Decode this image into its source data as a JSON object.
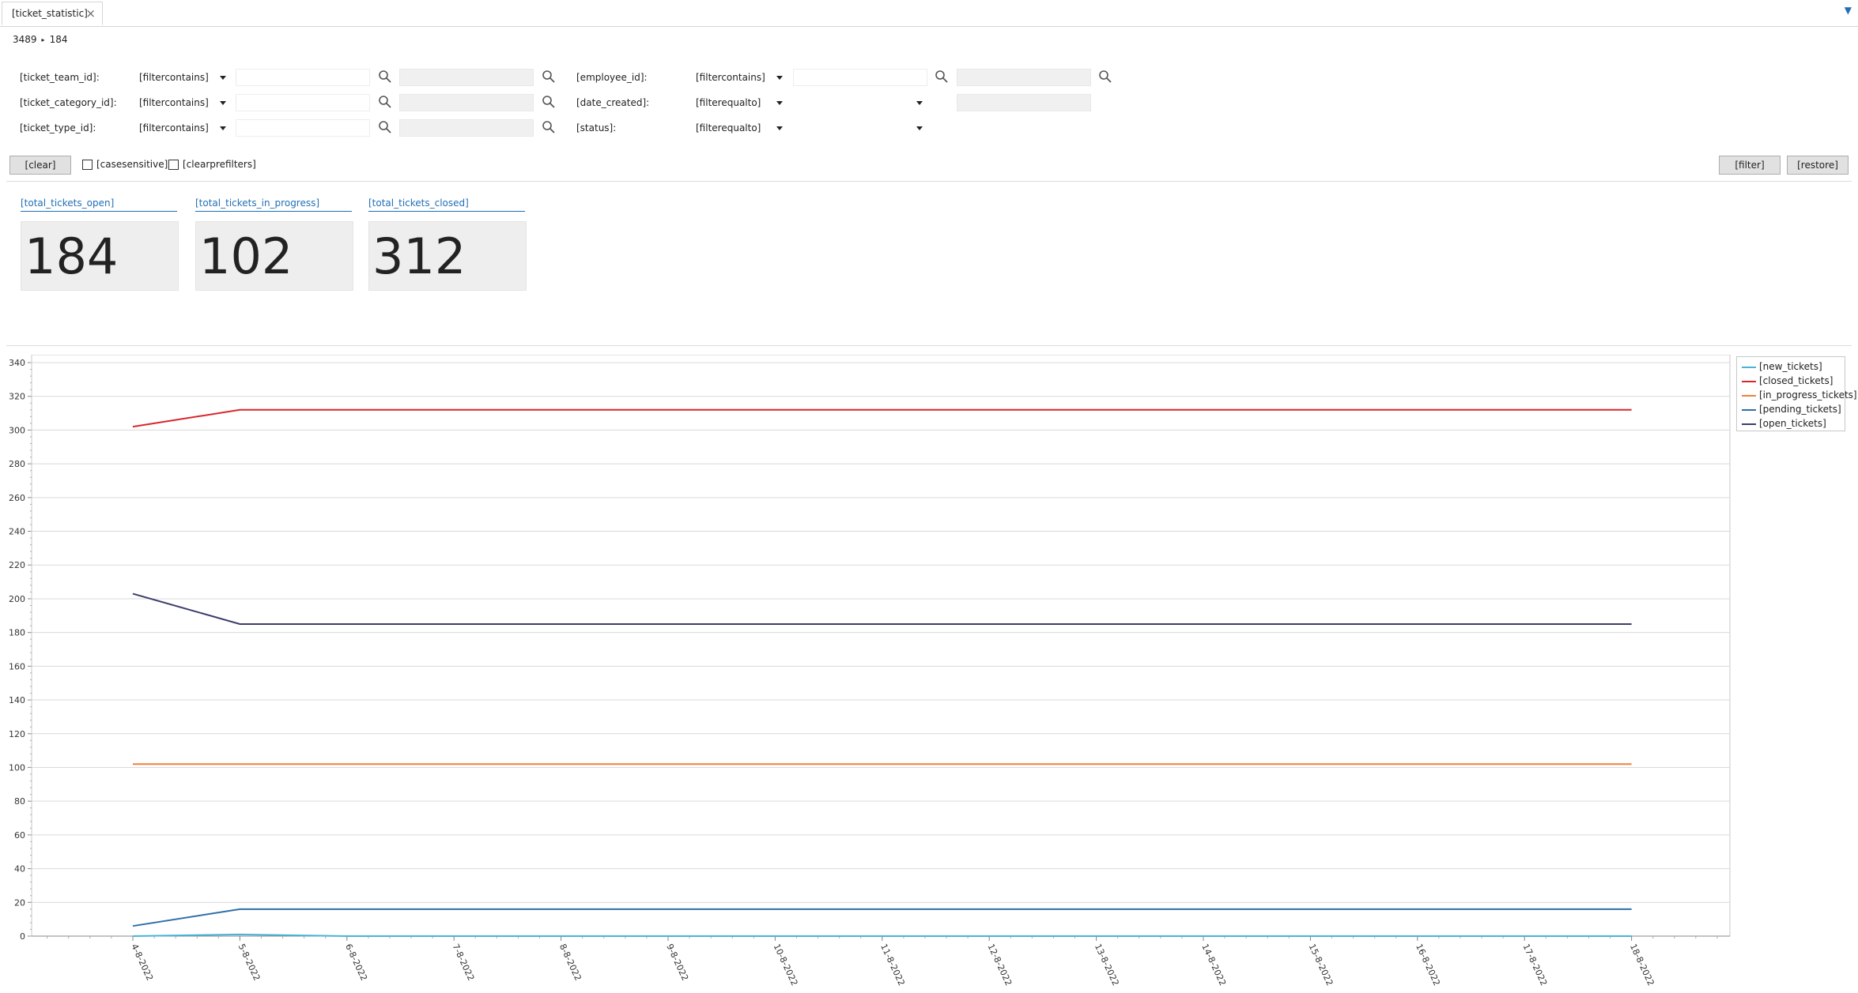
{
  "tab": {
    "title": "[ticket_statistic]",
    "close": "×"
  },
  "breadcrumb": {
    "first": "3489",
    "sep": "▸",
    "second": "184"
  },
  "filters": {
    "ticket_team_id": {
      "label": "[ticket_team_id]:",
      "mode": "[filtercontains]",
      "value": ""
    },
    "ticket_category_id": {
      "label": "[ticket_category_id]:",
      "mode": "[filtercontains]",
      "value": ""
    },
    "ticket_type_id": {
      "label": "[ticket_type_id]:",
      "mode": "[filtercontains]",
      "value": ""
    },
    "employee_id": {
      "label": "[employee_id]:",
      "mode": "[filtercontains]",
      "value": ""
    },
    "date_created": {
      "label": "[date_created]:",
      "mode": "[filterequalto]",
      "value": ""
    },
    "status": {
      "label": "[status]:",
      "mode": "[filterequalto]",
      "value": ""
    }
  },
  "actions": {
    "clear": "[clear]",
    "casesensitive": "[casesensitive]",
    "clearprefilters": "[clearprefilters]",
    "filter": "[filter]",
    "restore": "[restore]"
  },
  "kpis": {
    "open": {
      "title": "[total_tickets_open]",
      "value": "184"
    },
    "in_progress": {
      "title": "[total_tickets_in_progress]",
      "value": "102"
    },
    "closed": {
      "title": "[total_tickets_closed]",
      "value": "312"
    }
  },
  "chart_data": {
    "type": "line",
    "title": "",
    "xlabel": "",
    "ylabel": "",
    "ylim": [
      0,
      340
    ],
    "yticks": [
      0,
      20,
      40,
      60,
      80,
      100,
      120,
      140,
      160,
      180,
      200,
      220,
      240,
      260,
      280,
      300,
      320,
      340
    ],
    "grid": true,
    "legend_position": "right",
    "categories": [
      "4-8-2022",
      "5-8-2022",
      "6-8-2022",
      "7-8-2022",
      "8-8-2022",
      "9-8-2022",
      "10-8-2022",
      "11-8-2022",
      "12-8-2022",
      "13-8-2022",
      "14-8-2022",
      "15-8-2022",
      "16-8-2022",
      "17-8-2022",
      "18-8-2022"
    ],
    "series": [
      {
        "name": "[new_tickets]",
        "color": "#4ab3d6",
        "values": [
          0,
          1,
          0,
          0,
          0,
          0,
          0,
          0,
          0,
          0,
          0,
          0,
          0,
          0,
          0
        ]
      },
      {
        "name": "[closed_tickets]",
        "color": "#d9262b",
        "values": [
          302,
          312,
          312,
          312,
          312,
          312,
          312,
          312,
          312,
          312,
          312,
          312,
          312,
          312,
          312
        ]
      },
      {
        "name": "[in_progress_tickets]",
        "color": "#f07f3c",
        "values": [
          102,
          102,
          102,
          102,
          102,
          102,
          102,
          102,
          102,
          102,
          102,
          102,
          102,
          102,
          102
        ]
      },
      {
        "name": "[pending_tickets]",
        "color": "#2f6fa8",
        "values": [
          6,
          16,
          16,
          16,
          16,
          16,
          16,
          16,
          16,
          16,
          16,
          16,
          16,
          16,
          16
        ]
      },
      {
        "name": "[open_tickets]",
        "color": "#3b3d6b",
        "values": [
          203,
          185,
          185,
          185,
          185,
          185,
          185,
          185,
          185,
          185,
          185,
          185,
          185,
          185,
          185
        ]
      }
    ]
  }
}
